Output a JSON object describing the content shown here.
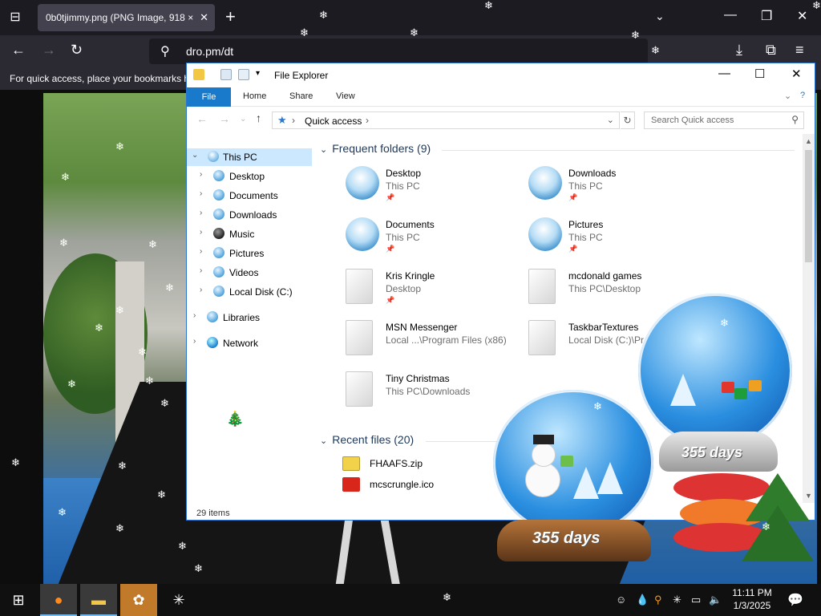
{
  "browser": {
    "tab_title": "0b0tjimmy.png (PNG Image, 918 ×",
    "tab_close": "✕",
    "new_tab": "+",
    "url": "dro.pm/dt",
    "bookmarks_hint": "For quick access, place your bookmarks h"
  },
  "explorer": {
    "title": "File Explorer",
    "ribbon_tabs": [
      "File",
      "Home",
      "Share",
      "View"
    ],
    "address_path": "Quick access",
    "search_placeholder": "Search Quick access",
    "nav_tree": [
      {
        "label": "This PC",
        "expanded": true,
        "selected": true
      },
      {
        "label": "Desktop"
      },
      {
        "label": "Documents"
      },
      {
        "label": "Downloads"
      },
      {
        "label": "Music"
      },
      {
        "label": "Pictures"
      },
      {
        "label": "Videos"
      },
      {
        "label": "Local Disk (C:)"
      },
      {
        "label": "Libraries"
      },
      {
        "label": "Network"
      }
    ],
    "frequent_header": "Frequent folders (9)",
    "frequent": [
      {
        "name": "Desktop",
        "path": "This PC"
      },
      {
        "name": "Downloads",
        "path": "This PC"
      },
      {
        "name": "Documents",
        "path": "This PC"
      },
      {
        "name": "Pictures",
        "path": "This PC"
      },
      {
        "name": "Kris Kringle",
        "path": "Desktop"
      },
      {
        "name": "mcdonald games",
        "path": "This PC\\Desktop"
      },
      {
        "name": "MSN Messenger",
        "path": "Local ...\\Program Files (x86)"
      },
      {
        "name": "TaskbarTextures",
        "path": "Local Disk (C:)\\Pr"
      },
      {
        "name": "Tiny Christmas",
        "path": "This PC\\Downloads"
      }
    ],
    "recent_header": "Recent files (20)",
    "recent": [
      {
        "name": "FHAAFS.zip"
      },
      {
        "name": "mcscrungle.ico"
      }
    ],
    "status": "29 items"
  },
  "desktop": {
    "globe_text": "355 days",
    "globe_text_2": "355 days"
  },
  "taskbar": {
    "time": "11:11 PM",
    "date": "1/3/2025"
  }
}
